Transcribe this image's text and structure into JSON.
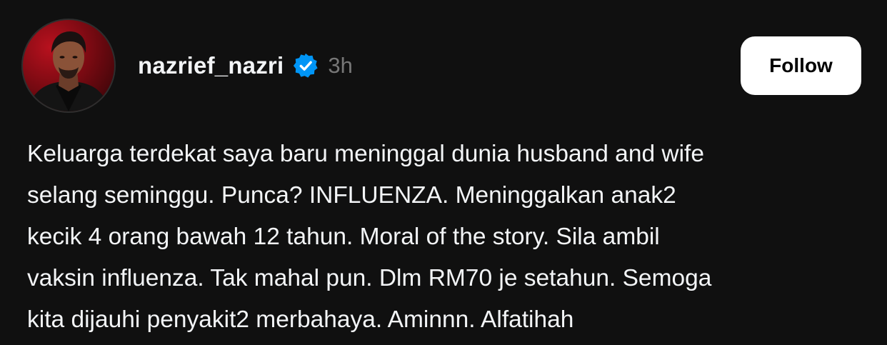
{
  "post": {
    "username": "nazrief_nazri",
    "verified_icon": "verified-badge-icon",
    "time": "3h",
    "follow_label": "Follow",
    "text_lines": [
      "Keluarga terdekat saya baru meninggal dunia husband and wife",
      "selang seminggu. Punca? INFLUENZA. Meninggalkan anak2",
      "kecik 4 orang bawah 12 tahun. Moral of the story. Sila ambil",
      "vaksin influenza. Tak mahal pun. Dlm RM70 je setahun. Semoga",
      "kita dijauhi penyakit2 merbahaya. Aminnn. Alfatihah"
    ]
  },
  "colors": {
    "background": "#101010",
    "text": "#f3f5f7",
    "muted": "#777777",
    "verified": "#0095f6",
    "button_bg": "#ffffff",
    "button_text": "#000000"
  }
}
